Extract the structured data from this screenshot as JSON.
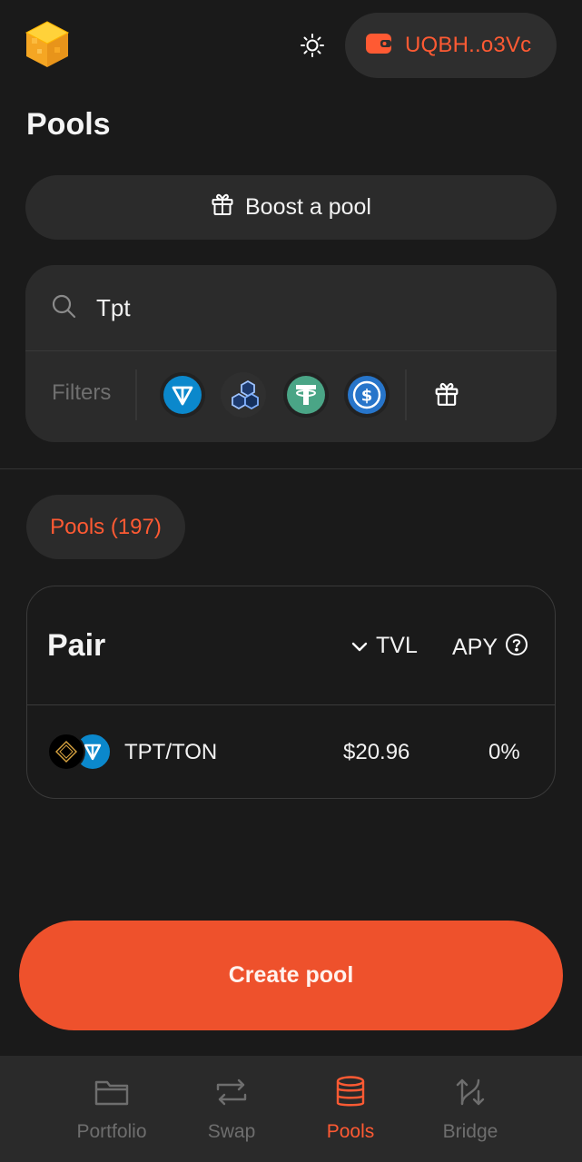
{
  "header": {
    "logo_icon": "cube-logo-icon",
    "theme_icon": "sun-icon",
    "wallet_address": "UQBH..o3Vc",
    "wallet_icon": "wallet-icon"
  },
  "page_title": "Pools",
  "boost": {
    "label": "Boost a pool",
    "icon": "gift-icon"
  },
  "search": {
    "value": "Tpt",
    "icon": "search-icon"
  },
  "filters": {
    "label": "Filters",
    "tokens": [
      "ton-token-icon",
      "hexagon-token-icon",
      "tether-token-icon",
      "usdc-token-icon"
    ],
    "gift_icon": "gift-icon"
  },
  "tabs": {
    "pools_label": "Pools (197)"
  },
  "table": {
    "headers": {
      "pair": "Pair",
      "tvl": "TVL",
      "apy": "APY"
    },
    "rows": [
      {
        "pair": "TPT/TON",
        "tvl": "$20.96",
        "apy": "0%"
      }
    ]
  },
  "create_button": "Create pool",
  "nav": [
    {
      "label": "Portfolio",
      "icon": "folder-icon",
      "active": false
    },
    {
      "label": "Swap",
      "icon": "swap-icon",
      "active": false
    },
    {
      "label": "Pools",
      "icon": "database-icon",
      "active": true
    },
    {
      "label": "Bridge",
      "icon": "bridge-icon",
      "active": false
    }
  ],
  "colors": {
    "accent": "#ee512c",
    "background": "#1a1a1a",
    "surface": "#2b2b2b"
  }
}
